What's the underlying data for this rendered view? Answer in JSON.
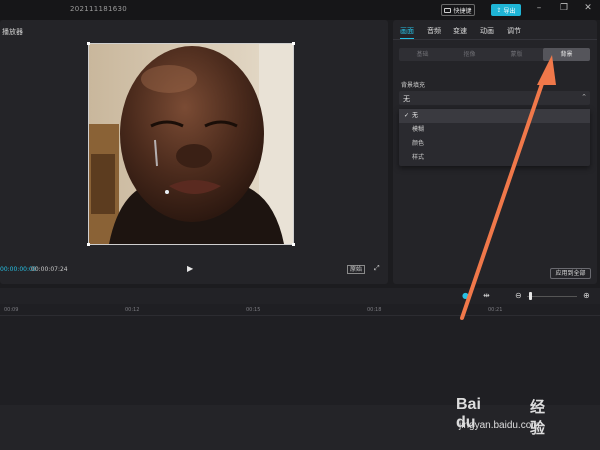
{
  "titlebar": {
    "project_name": "202111181630",
    "shortcut_label": "快捷键",
    "export_label": "导出",
    "minimize_glyph": "–",
    "restore_glyph": "❐",
    "close_glyph": "✕"
  },
  "player": {
    "title": "播放器",
    "current_time": "00:00:00:00",
    "total_time": "00:00:07:24",
    "original_label": "原始",
    "icons": {
      "play": "play-icon",
      "fullscreen": "fullscreen-icon"
    }
  },
  "right_panel": {
    "tabs": [
      {
        "label": "画面",
        "active": true
      },
      {
        "label": "音频",
        "active": false
      },
      {
        "label": "变速",
        "active": false
      },
      {
        "label": "动画",
        "active": false
      },
      {
        "label": "调节",
        "active": false
      }
    ],
    "subtabs": [
      {
        "label": "基础",
        "active": false
      },
      {
        "label": "抠像",
        "active": false
      },
      {
        "label": "蒙版",
        "active": false
      },
      {
        "label": "背景",
        "active": true
      }
    ],
    "background_fill_label": "背景填充",
    "background_fill_value": "无",
    "dropdown_options": [
      {
        "label": "无",
        "selected": true
      },
      {
        "label": "模糊",
        "selected": false
      },
      {
        "label": "颜色",
        "selected": false
      },
      {
        "label": "样式",
        "selected": false
      }
    ],
    "apply_all_label": "应用到全部"
  },
  "timeline": {
    "ticks": [
      "00:09",
      "00:12",
      "00:15",
      "00:18",
      "00:21"
    ]
  },
  "watermark": {
    "logo": "Bai du",
    "suffix": "经验",
    "url": "jingyan.baidu.com"
  },
  "colors": {
    "accent": "#27c0e3",
    "export_button": "#1fb5d6",
    "annotation_arrow": "#f0784a"
  }
}
